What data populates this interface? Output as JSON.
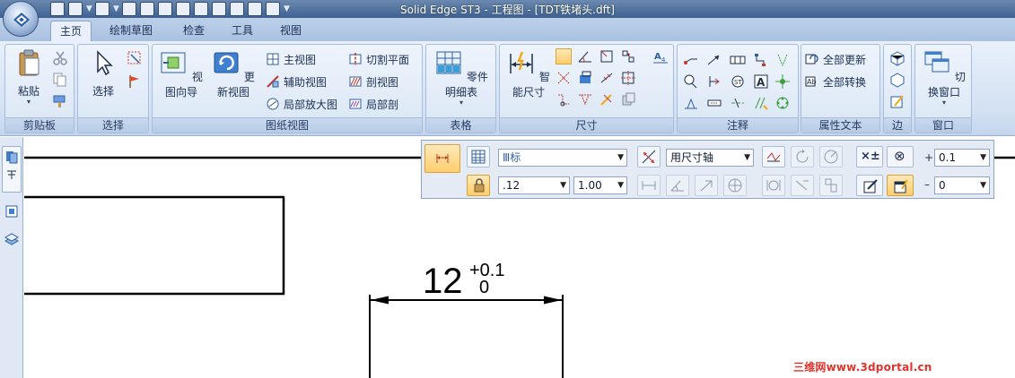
{
  "window": {
    "title": "Solid Edge ST3 - 工程图 - [TDT铁堵头.dft]"
  },
  "tabs": [
    {
      "label": "主页",
      "active": true
    },
    {
      "label": "绘制草图"
    },
    {
      "label": "检查"
    },
    {
      "label": "工具"
    },
    {
      "label": "视图"
    }
  ],
  "ribbon": {
    "clipboard": {
      "group": "剪贴板",
      "paste": "粘贴"
    },
    "select": {
      "group": "选择",
      "select": "选择"
    },
    "drawing_views": {
      "group": "图纸视图",
      "view_wizard": "视图向导",
      "update_views": "更新视图",
      "principal_view": "主视图",
      "auxiliary_view": "辅助视图",
      "detail_view": "局部放大图",
      "cutting_plane": "切割平面",
      "section_view": "剖视图",
      "broken_out_section": "局部剖"
    },
    "tables": {
      "group": "表格",
      "parts_list": "零件明细表"
    },
    "dimension": {
      "group": "尺寸",
      "smart_dimension": "智能尺寸"
    },
    "annotation": {
      "group": "注释"
    },
    "property_text": {
      "group": "属性文本",
      "update_all": "全部更新",
      "convert_all": "全部转换"
    },
    "edges": {
      "group": "边"
    },
    "window": {
      "group": "窗口",
      "switch_window": "切换窗口"
    }
  },
  "command_bar": {
    "style_value": "Ⅲ标",
    "dimension_axis_value": "用尺寸轴",
    "precision_value": ".12",
    "scale_value": "1.00",
    "upper_tol_sign": "+",
    "upper_tol_value": "0.1",
    "lower_tol_sign": "–",
    "lower_tol_value": "0",
    "tol_button": "×±",
    "close_button": "⊗"
  },
  "drawing": {
    "dimension_value": "12",
    "upper_tolerance": "+0.1",
    "lower_tolerance": "0"
  },
  "watermark": "三维网www.3dportal.cn",
  "colors": {
    "accent_orange": "#ffce6d",
    "ribbon_blue": "#d3e1f3",
    "watermark_red": "#e0342b"
  }
}
